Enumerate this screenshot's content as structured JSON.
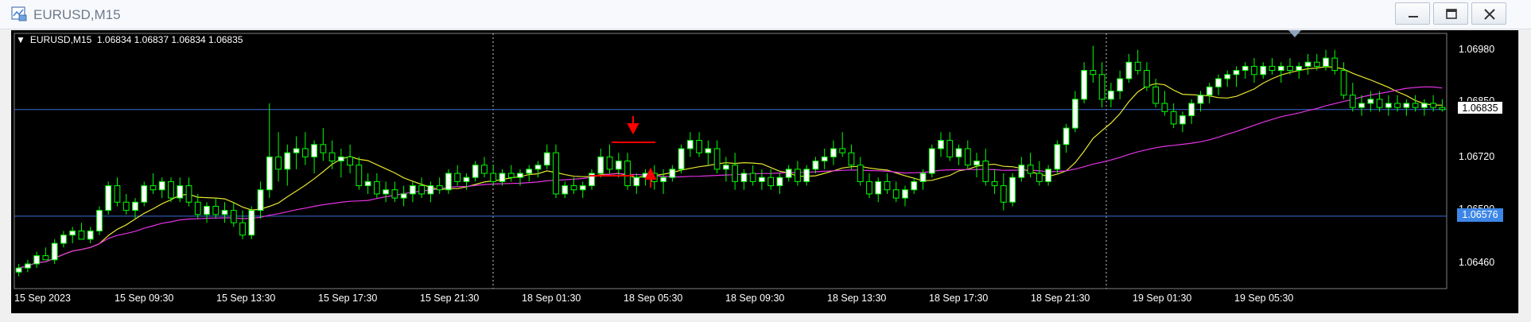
{
  "window": {
    "title": "EURUSD,M15",
    "icon": "chart-window-icon",
    "controls": [
      "minimize-icon",
      "maximize-icon",
      "close-icon"
    ]
  },
  "chart": {
    "symbol_label": "EURUSD,M15",
    "ohlc_label": "1.06834 1.06837 1.06834 1.06835",
    "current_price_tag": "1.06835",
    "line_price_tag": "1.06576",
    "colors": {
      "background": "#000000",
      "candle_up": "#ffffff",
      "candle_outline": "#00ff00",
      "ma_fast": "#e6e632",
      "ma_slow": "#e632e6",
      "horizontal_line": "#3d6bd6",
      "annotation": "#ff0000"
    }
  },
  "chart_data": {
    "type": "candlestick",
    "symbol": "EURUSD",
    "timeframe": "M15",
    "ylim": [
      1.064,
      1.0702
    ],
    "y_ticks": [
      "1.06980",
      "1.06850",
      "1.06720",
      "1.06590",
      "1.06460"
    ],
    "x_ticks": [
      "15 Sep 2023",
      "15 Sep 09:30",
      "15 Sep 13:30",
      "15 Sep 17:30",
      "15 Sep 21:30",
      "18 Sep 01:30",
      "18 Sep 05:30",
      "18 Sep 09:30",
      "18 Sep 13:30",
      "18 Sep 17:30",
      "18 Sep 21:30",
      "19 Sep 01:30",
      "19 Sep 05:30"
    ],
    "horizontal_lines": [
      1.06835,
      1.06576
    ],
    "candles": [
      [
        1.0644,
        1.0646,
        1.0643,
        1.0645
      ],
      [
        1.0645,
        1.0647,
        1.0644,
        1.0646
      ],
      [
        1.0646,
        1.0649,
        1.0645,
        1.0648
      ],
      [
        1.0648,
        1.065,
        1.0647,
        1.0647
      ],
      [
        1.0647,
        1.0652,
        1.0646,
        1.0651
      ],
      [
        1.0651,
        1.0654,
        1.065,
        1.0653
      ],
      [
        1.0653,
        1.0655,
        1.0651,
        1.0654
      ],
      [
        1.0654,
        1.0656,
        1.0652,
        1.0652
      ],
      [
        1.0652,
        1.0655,
        1.0651,
        1.0654
      ],
      [
        1.0654,
        1.066,
        1.0653,
        1.0659
      ],
      [
        1.0659,
        1.0666,
        1.0658,
        1.0665
      ],
      [
        1.0665,
        1.0667,
        1.066,
        1.0661
      ],
      [
        1.0661,
        1.0663,
        1.0658,
        1.0659
      ],
      [
        1.0659,
        1.0662,
        1.0657,
        1.0661
      ],
      [
        1.0661,
        1.0666,
        1.066,
        1.0665
      ],
      [
        1.0665,
        1.0668,
        1.0663,
        1.0664
      ],
      [
        1.0664,
        1.0667,
        1.0662,
        1.0666
      ],
      [
        1.0666,
        1.0667,
        1.0661,
        1.0662
      ],
      [
        1.0662,
        1.0667,
        1.0661,
        1.0665
      ],
      [
        1.0665,
        1.0667,
        1.066,
        1.0661
      ],
      [
        1.0661,
        1.0663,
        1.0657,
        1.0658
      ],
      [
        1.0658,
        1.0661,
        1.0656,
        1.066
      ],
      [
        1.066,
        1.0662,
        1.0657,
        1.0658
      ],
      [
        1.0658,
        1.0661,
        1.0656,
        1.0659
      ],
      [
        1.0659,
        1.0661,
        1.0655,
        1.0656
      ],
      [
        1.0656,
        1.0659,
        1.0652,
        1.0653
      ],
      [
        1.0653,
        1.066,
        1.0652,
        1.0659
      ],
      [
        1.0659,
        1.0666,
        1.0657,
        1.0664
      ],
      [
        1.0664,
        1.0685,
        1.0662,
        1.0672
      ],
      [
        1.0672,
        1.0678,
        1.0666,
        1.0669
      ],
      [
        1.0669,
        1.0675,
        1.0665,
        1.0673
      ],
      [
        1.0673,
        1.0677,
        1.0669,
        1.0674
      ],
      [
        1.0674,
        1.0678,
        1.067,
        1.0672
      ],
      [
        1.0672,
        1.0676,
        1.0668,
        1.0675
      ],
      [
        1.0675,
        1.0679,
        1.0671,
        1.0673
      ],
      [
        1.0673,
        1.0676,
        1.0669,
        1.0671
      ],
      [
        1.0671,
        1.0674,
        1.0667,
        1.0672
      ],
      [
        1.0672,
        1.0675,
        1.0668,
        1.067
      ],
      [
        1.067,
        1.0672,
        1.0664,
        1.0665
      ],
      [
        1.0665,
        1.0668,
        1.0663,
        1.0666
      ],
      [
        1.0666,
        1.0668,
        1.0662,
        1.0663
      ],
      [
        1.0663,
        1.0666,
        1.0661,
        1.0664
      ],
      [
        1.0664,
        1.0666,
        1.0661,
        1.0662
      ],
      [
        1.0662,
        1.0665,
        1.066,
        1.0663
      ],
      [
        1.0663,
        1.0666,
        1.0661,
        1.0665
      ],
      [
        1.0665,
        1.0667,
        1.0662,
        1.0663
      ],
      [
        1.0663,
        1.0666,
        1.0661,
        1.0665
      ],
      [
        1.0665,
        1.0667,
        1.0663,
        1.0664
      ],
      [
        1.0664,
        1.0669,
        1.0663,
        1.0668
      ],
      [
        1.0668,
        1.067,
        1.0665,
        1.0666
      ],
      [
        1.0666,
        1.0668,
        1.0664,
        1.0667
      ],
      [
        1.0667,
        1.0671,
        1.0666,
        1.067
      ],
      [
        1.067,
        1.0672,
        1.0667,
        1.0668
      ],
      [
        1.0668,
        1.067,
        1.0665,
        1.0666
      ],
      [
        1.0666,
        1.0669,
        1.0665,
        1.0668
      ],
      [
        1.0668,
        1.067,
        1.0666,
        1.0667
      ],
      [
        1.0667,
        1.0669,
        1.0665,
        1.0668
      ],
      [
        1.0668,
        1.067,
        1.0666,
        1.0669
      ],
      [
        1.0669,
        1.0671,
        1.0667,
        1.067
      ],
      [
        1.067,
        1.0675,
        1.0669,
        1.0673
      ],
      [
        1.0673,
        1.0675,
        1.0662,
        1.0663
      ],
      [
        1.0663,
        1.0666,
        1.0662,
        1.0665
      ],
      [
        1.0665,
        1.0667,
        1.0663,
        1.0664
      ],
      [
        1.0664,
        1.0666,
        1.0662,
        1.0665
      ],
      [
        1.0665,
        1.0669,
        1.0664,
        1.0668
      ],
      [
        1.0668,
        1.0674,
        1.0667,
        1.0672
      ],
      [
        1.0672,
        1.0675,
        1.0668,
        1.0669
      ],
      [
        1.0669,
        1.0673,
        1.0667,
        1.0671
      ],
      [
        1.0671,
        1.0673,
        1.0664,
        1.0665
      ],
      [
        1.0665,
        1.0668,
        1.0663,
        1.0667
      ],
      [
        1.0667,
        1.0669,
        1.0665,
        1.0668
      ],
      [
        1.0668,
        1.067,
        1.0664,
        1.0666
      ],
      [
        1.0666,
        1.0669,
        1.0663,
        1.0667
      ],
      [
        1.0667,
        1.067,
        1.0666,
        1.0669
      ],
      [
        1.0669,
        1.0675,
        1.0668,
        1.0674
      ],
      [
        1.0674,
        1.0678,
        1.0672,
        1.0676
      ],
      [
        1.0676,
        1.0678,
        1.0672,
        1.0673
      ],
      [
        1.0673,
        1.0676,
        1.067,
        1.0674
      ],
      [
        1.0674,
        1.0676,
        1.0668,
        1.0669
      ],
      [
        1.0669,
        1.0672,
        1.0666,
        1.067
      ],
      [
        1.067,
        1.0673,
        1.0664,
        1.0666
      ],
      [
        1.0666,
        1.0669,
        1.0664,
        1.0668
      ],
      [
        1.0668,
        1.067,
        1.0665,
        1.0666
      ],
      [
        1.0666,
        1.0669,
        1.0664,
        1.0667
      ],
      [
        1.0667,
        1.0669,
        1.0664,
        1.0665
      ],
      [
        1.0665,
        1.0668,
        1.0663,
        1.0667
      ],
      [
        1.0667,
        1.067,
        1.0666,
        1.0669
      ],
      [
        1.0669,
        1.0671,
        1.0665,
        1.0666
      ],
      [
        1.0666,
        1.067,
        1.0665,
        1.0669
      ],
      [
        1.0669,
        1.0672,
        1.0668,
        1.0671
      ],
      [
        1.0671,
        1.0674,
        1.0669,
        1.0672
      ],
      [
        1.0672,
        1.0676,
        1.067,
        1.0674
      ],
      [
        1.0674,
        1.0678,
        1.0672,
        1.0673
      ],
      [
        1.0673,
        1.0675,
        1.0669,
        1.067
      ],
      [
        1.067,
        1.0672,
        1.0665,
        1.0666
      ],
      [
        1.0666,
        1.0668,
        1.0662,
        1.0663
      ],
      [
        1.0663,
        1.0667,
        1.0661,
        1.0666
      ],
      [
        1.0666,
        1.0668,
        1.0663,
        1.0664
      ],
      [
        1.0664,
        1.0666,
        1.0661,
        1.0662
      ],
      [
        1.0662,
        1.0665,
        1.066,
        1.0664
      ],
      [
        1.0664,
        1.0667,
        1.0663,
        1.0666
      ],
      [
        1.0666,
        1.0669,
        1.0664,
        1.0668
      ],
      [
        1.0668,
        1.0675,
        1.0667,
        1.0674
      ],
      [
        1.0674,
        1.0678,
        1.0672,
        1.0676
      ],
      [
        1.0676,
        1.0678,
        1.0671,
        1.0672
      ],
      [
        1.0672,
        1.0675,
        1.067,
        1.0674
      ],
      [
        1.0674,
        1.0676,
        1.0669,
        1.067
      ],
      [
        1.067,
        1.0673,
        1.0667,
        1.0671
      ],
      [
        1.0671,
        1.0674,
        1.0665,
        1.0666
      ],
      [
        1.0666,
        1.0669,
        1.0663,
        1.0665
      ],
      [
        1.0665,
        1.0668,
        1.0659,
        1.0661
      ],
      [
        1.0661,
        1.0668,
        1.066,
        1.0667
      ],
      [
        1.0667,
        1.0672,
        1.0666,
        1.067
      ],
      [
        1.067,
        1.0673,
        1.0667,
        1.0668
      ],
      [
        1.0668,
        1.0671,
        1.0665,
        1.0666
      ],
      [
        1.0666,
        1.067,
        1.0665,
        1.0669
      ],
      [
        1.0669,
        1.0676,
        1.0668,
        1.0675
      ],
      [
        1.0675,
        1.068,
        1.0673,
        1.0679
      ],
      [
        1.0679,
        1.0688,
        1.0678,
        1.0686
      ],
      [
        1.0686,
        1.0695,
        1.0685,
        1.0693
      ],
      [
        1.0693,
        1.0699,
        1.069,
        1.0692
      ],
      [
        1.0692,
        1.0695,
        1.0684,
        1.0686
      ],
      [
        1.0686,
        1.069,
        1.0684,
        1.0688
      ],
      [
        1.0688,
        1.0693,
        1.0686,
        1.0691
      ],
      [
        1.0691,
        1.0697,
        1.069,
        1.0695
      ],
      [
        1.0695,
        1.0698,
        1.0692,
        1.0693
      ],
      [
        1.0693,
        1.0695,
        1.0688,
        1.0689
      ],
      [
        1.0689,
        1.0691,
        1.0684,
        1.0685
      ],
      [
        1.0685,
        1.0688,
        1.0682,
        1.0683
      ],
      [
        1.0683,
        1.0685,
        1.0679,
        1.068
      ],
      [
        1.068,
        1.0683,
        1.0678,
        1.0682
      ],
      [
        1.0682,
        1.0686,
        1.068,
        1.0685
      ],
      [
        1.0685,
        1.0688,
        1.0683,
        1.0687
      ],
      [
        1.0687,
        1.069,
        1.0685,
        1.0689
      ],
      [
        1.0689,
        1.0692,
        1.0687,
        1.0691
      ],
      [
        1.0691,
        1.0693,
        1.0689,
        1.0692
      ],
      [
        1.0692,
        1.0694,
        1.0689,
        1.0693
      ],
      [
        1.0693,
        1.0695,
        1.0691,
        1.0694
      ],
      [
        1.0694,
        1.0696,
        1.069,
        1.0692
      ],
      [
        1.0692,
        1.0695,
        1.0691,
        1.0694
      ],
      [
        1.0694,
        1.0696,
        1.0692,
        1.0693
      ],
      [
        1.0693,
        1.0695,
        1.069,
        1.0694
      ],
      [
        1.0694,
        1.0696,
        1.0692,
        1.0693
      ],
      [
        1.0693,
        1.0695,
        1.0691,
        1.0694
      ],
      [
        1.0694,
        1.0697,
        1.0692,
        1.0695
      ],
      [
        1.0695,
        1.0697,
        1.0693,
        1.0694
      ],
      [
        1.0694,
        1.0698,
        1.0693,
        1.0696
      ],
      [
        1.0696,
        1.0698,
        1.0692,
        1.0693
      ],
      [
        1.0693,
        1.0695,
        1.0686,
        1.0687
      ],
      [
        1.0687,
        1.069,
        1.0683,
        1.0684
      ],
      [
        1.0684,
        1.0687,
        1.0682,
        1.0685
      ],
      [
        1.0685,
        1.0688,
        1.0683,
        1.0686
      ],
      [
        1.0686,
        1.0688,
        1.0683,
        1.0684
      ],
      [
        1.0684,
        1.0687,
        1.0682,
        1.0685
      ],
      [
        1.0685,
        1.0687,
        1.0683,
        1.0684
      ],
      [
        1.0684,
        1.0686,
        1.0682,
        1.0685
      ],
      [
        1.0685,
        1.0687,
        1.0683,
        1.0684
      ],
      [
        1.0684,
        1.0686,
        1.0682,
        1.0685
      ],
      [
        1.0685,
        1.0687,
        1.0683,
        1.0684
      ],
      [
        1.0684,
        1.0686,
        1.0683,
        1.06835
      ]
    ]
  }
}
